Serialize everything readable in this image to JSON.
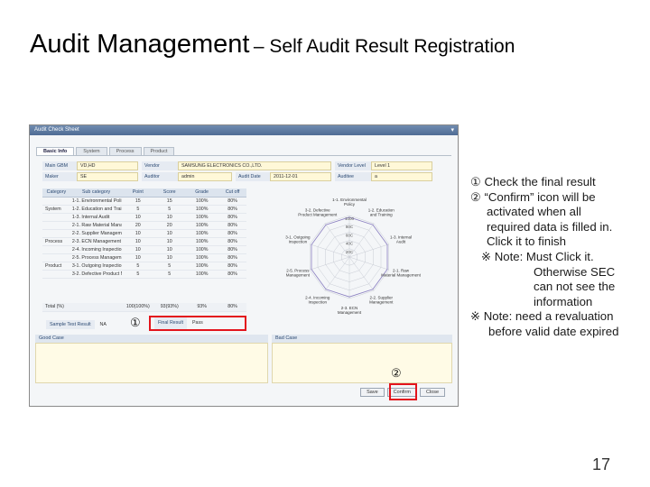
{
  "slide": {
    "title_main": "Audit Management",
    "title_sub": "– Self Audit Result Registration",
    "page_number": "17"
  },
  "window": {
    "title": "Audit Check Sheet",
    "close": "▾",
    "tabs": [
      "Basic Info",
      "System",
      "Process",
      "Product"
    ],
    "form": {
      "row1": [
        {
          "label": "Main GBM",
          "value": "VD,HD"
        },
        {
          "label": "Vendor",
          "value": "SAMSUNG ELECTRONICS CO.,LTD."
        },
        {
          "label": "Vendor Level",
          "value": "Level 1"
        }
      ],
      "row2": [
        {
          "label": "Maker",
          "value": "SE"
        },
        {
          "label": "Auditor",
          "value": "admin"
        },
        {
          "label": "Audit Date",
          "value": "2011-12-01"
        },
        {
          "label": "Auditee",
          "value": "a"
        }
      ]
    },
    "grid": {
      "headers": [
        "Category",
        "Sub category",
        "Point",
        "Score",
        "Grade",
        "Cut off"
      ],
      "rows": [
        [
          "",
          "1-1. Environmental Poli",
          "15",
          "15",
          "100%",
          "80%"
        ],
        [
          "System",
          "1-2. Education and Trai",
          "5",
          "5",
          "100%",
          "80%"
        ],
        [
          "",
          "1-3. Internal Audit",
          "10",
          "10",
          "100%",
          "80%"
        ],
        [
          "",
          "2-1. Raw Material Mana",
          "20",
          "20",
          "100%",
          "80%"
        ],
        [
          "",
          "2-2. Supplier Managem",
          "10",
          "10",
          "100%",
          "80%"
        ],
        [
          "Process",
          "2-3. ECN Management",
          "10",
          "10",
          "100%",
          "80%"
        ],
        [
          "",
          "2-4. Incoming Inspection",
          "10",
          "10",
          "100%",
          "80%"
        ],
        [
          "",
          "2-5. Process Managem",
          "10",
          "10",
          "100%",
          "80%"
        ],
        [
          "Product",
          "3-1. Outgoing Inspection",
          "5",
          "5",
          "100%",
          "80%"
        ],
        [
          "",
          "3-2. Defective Product M",
          "5",
          "5",
          "100%",
          "80%"
        ]
      ],
      "total": [
        "Total (%)",
        "",
        "100(100%)",
        "93(93%)",
        "93%",
        "80%"
      ]
    },
    "radar": {
      "axes": [
        "1-1. Environmental Policy",
        "1-2. Education and Training",
        "1-3. Internal Audit",
        "2-1. Raw Material Management",
        "2-2. Supplier Management",
        "2-3. ECN Management",
        "2-4. Incoming Inspection",
        "2-5. Process Management",
        "3-1. Outgoing Inspection",
        "3-2. Defective Product Management"
      ],
      "ticks": [
        "1000",
        "80C",
        "60C",
        "40C",
        "20C"
      ]
    },
    "sample_test_label": "Sample Test Result",
    "sample_test_value": "NA",
    "final_result_label": "Final Result",
    "final_result_value": "Pass",
    "good_case": "Good Case",
    "bad_case": "Bad Case",
    "buttons": {
      "save": "Save",
      "confirm": "Confirm",
      "close": "Close"
    }
  },
  "markers": {
    "one": "①",
    "two": "②"
  },
  "notes": {
    "n1": "① Check the final result",
    "n2a": "② “Confirm” icon will be",
    "n2b": "activated when all",
    "n2c": "required data is filled in.",
    "n2d": "Click it to finish",
    "n3a": "※ Note: Must Click it.",
    "n3b": "Otherwise SEC",
    "n3c": "can not see the",
    "n3d": "information",
    "n4a": "※ Note: need a revaluation",
    "n4b": "before valid date expired"
  },
  "colors": {
    "highlight": "#e3141c",
    "header": "#4e6c94"
  }
}
